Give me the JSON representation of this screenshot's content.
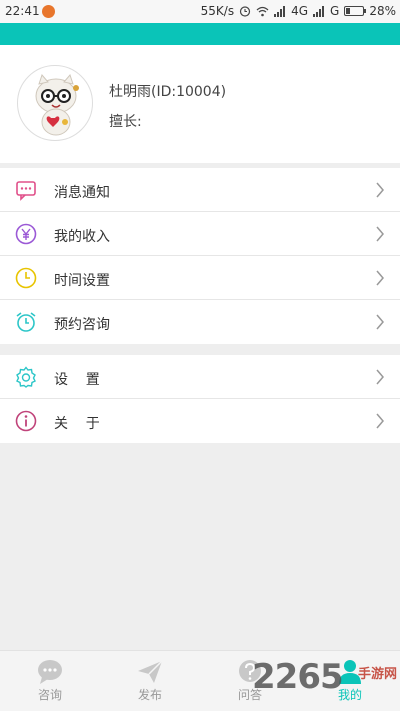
{
  "status_bar": {
    "time": "22:41",
    "speed": "55K/s",
    "net_left": "4G",
    "net_right": "G",
    "battery_text": "28%",
    "battery_level": 0.28
  },
  "profile": {
    "name": "杜明雨(ID:10004)",
    "skill_label": "擅长:"
  },
  "menu_group_1": [
    {
      "label": "消息通知",
      "icon": "message-icon"
    },
    {
      "label": "我的收入",
      "icon": "yen-icon"
    },
    {
      "label": "时间设置",
      "icon": "clock-icon"
    },
    {
      "label": "预约咨询",
      "icon": "alarm-icon"
    }
  ],
  "menu_group_2": [
    {
      "label": "设    置",
      "icon": "gear-icon"
    },
    {
      "label": "关    于",
      "icon": "info-icon"
    }
  ],
  "tabs": [
    {
      "label": "咨询",
      "icon": "chat-icon"
    },
    {
      "label": "发布",
      "icon": "send-icon"
    },
    {
      "label": "问答",
      "icon": "question-icon"
    },
    {
      "label": "我的",
      "icon": "person-icon",
      "active": true
    }
  ],
  "watermark": {
    "number": "2265",
    "text": "手游网"
  },
  "colors": {
    "accent": "#0ac4b8",
    "message": "#e0508a",
    "yen": "#9b59d6",
    "clock": "#e8c400",
    "alarm": "#2cc6c8",
    "gear": "#2cc6c8",
    "info": "#c0437a"
  }
}
